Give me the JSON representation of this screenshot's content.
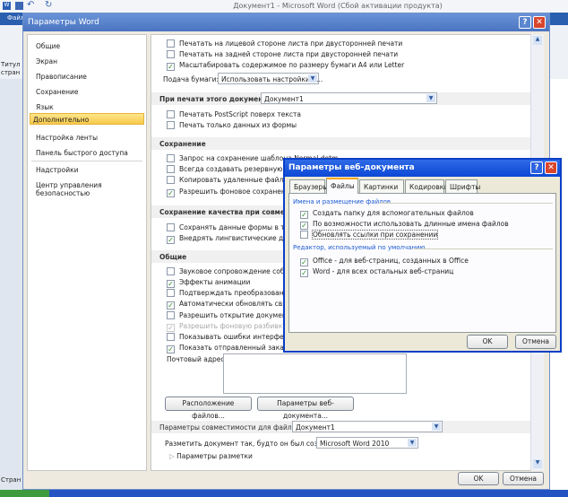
{
  "word": {
    "title": "Документ1 - Microsoft Word (Сбой активации продукта)",
    "file_tab": "Файл",
    "ribbon_text": [
      "Титул",
      "стран"
    ],
    "status": "Стран"
  },
  "options": {
    "title": "Параметры Word",
    "nav": [
      "Общие",
      "Экран",
      "Правописание",
      "Сохранение",
      "Язык",
      "Дополнительно",
      "Настройка ленты",
      "Панель быстрого доступа",
      "Надстройки",
      "Центр управления безопасностью"
    ],
    "print_rows": [
      {
        "label": "Печатать на лицевой стороне листа при двусторонней печати",
        "checked": false
      },
      {
        "label": "Печатать на задней стороне листа при двусторонней печати",
        "checked": false
      },
      {
        "label": "Масштабировать содержимое по размеру бумаги A4 или Letter",
        "checked": true
      }
    ],
    "paper_feed_label": "Подача бумаги:",
    "paper_feed_value": "Использовать настройки п...",
    "print_doc_header": "При печати этого документа:",
    "print_doc_value": "Документ1",
    "print_doc_rows": [
      {
        "label": "Печатать PostScript поверх текста",
        "checked": false
      },
      {
        "label": "Печать только данных из формы",
        "checked": false
      }
    ],
    "save_header": "Сохранение",
    "save_rows": [
      {
        "label": "Запрос на сохранение шаблона Normal.dotm",
        "checked": false
      },
      {
        "label": "Всегда создавать резервную копию",
        "checked": false
      },
      {
        "label": "Копировать удаленные файлы на этот компьютер",
        "checked": false
      },
      {
        "label": "Разрешить фоновое сохранение",
        "checked": true
      }
    ],
    "quality_header": "Сохранение качества при совместном использовании документа:",
    "quality_rows": [
      {
        "label": "Сохранять данные формы в текстовом формате",
        "checked": false
      },
      {
        "label": "Внедрять лингвистические данные",
        "checked": true
      }
    ],
    "general_header": "Общие",
    "general_rows": [
      {
        "label": "Звуковое сопровождение событий",
        "checked": false
      },
      {
        "label": "Эффекты анимации",
        "checked": true
      },
      {
        "label": "Подтверждать преобразование формата файла при открытии",
        "checked": false
      },
      {
        "label": "Автоматически обновлять связи при открытии",
        "checked": true
      },
      {
        "label": "Разрешить открытие документа в режиме черновика",
        "checked": false
      },
      {
        "label": "Разрешить фоновую разбивку на страницы",
        "checked": true,
        "disabled": true
      },
      {
        "label": "Показывать ошибки интерфейса пользователя надстроек",
        "checked": false
      },
      {
        "label": "Показать отправленный заказчиком контент Office.com",
        "checked": true
      }
    ],
    "mail_label": "Почтовый адрес:",
    "file_locations_btn": "Расположение файлов...",
    "web_options_btn": "Параметры веб-документа...",
    "compat_header": "Параметры совместимости для файла:",
    "compat_value": "Документ1",
    "layout_label": "Разметить документ так, будто он был создан в:",
    "layout_value": "Microsoft Word 2010",
    "layout_options": "Параметры разметки",
    "ok": "OK",
    "cancel": "Отмена"
  },
  "web": {
    "title": "Параметры веб-документа",
    "tabs": [
      "Браузеры",
      "Файлы",
      "Картинки",
      "Кодировка",
      "Шрифты"
    ],
    "group1": "Имена и размещение файлов",
    "group1_rows": [
      {
        "label": "Создать папку для вспомогательных файлов",
        "checked": true
      },
      {
        "label": "По возможности использовать длинные имена файлов",
        "checked": true
      },
      {
        "label": "Обновлять ссылки при сохранении",
        "checked": false
      }
    ],
    "group2": "Редактор, используемый по умолчанию",
    "group2_rows": [
      {
        "label": "Office - для веб-страниц, созданных в Office",
        "checked": true
      },
      {
        "label": "Word - для всех остальных веб-страниц",
        "checked": true
      }
    ],
    "ok": "OK",
    "cancel": "Отмена"
  }
}
